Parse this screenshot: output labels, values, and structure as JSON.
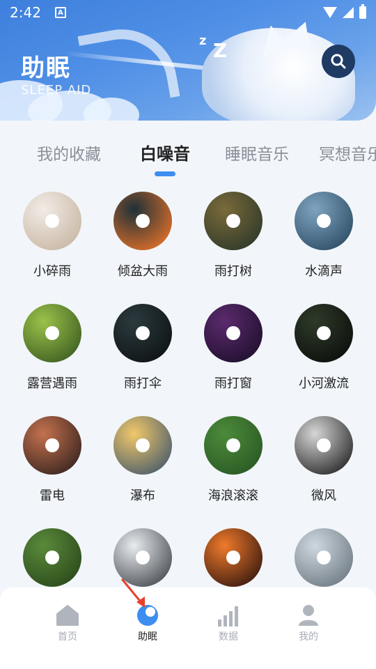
{
  "status_bar": {
    "time": "2:42",
    "notif_letter": "A"
  },
  "header": {
    "title": "助眠",
    "subtitle": "SLEEP AID",
    "zz": [
      "z",
      "Z"
    ]
  },
  "tabs": [
    {
      "label": "我的收藏",
      "active": false
    },
    {
      "label": "白噪音",
      "active": true
    },
    {
      "label": "睡眠音乐",
      "active": false
    },
    {
      "label": "冥想音乐",
      "active": false
    }
  ],
  "sounds": [
    {
      "label": "小碎雨",
      "colors": [
        "#f1ece6",
        "#c9b7a4"
      ]
    },
    {
      "label": "倾盆大雨",
      "colors": [
        "#1e3038",
        "#e0702a"
      ]
    },
    {
      "label": "雨打树",
      "colors": [
        "#7a6a3a",
        "#2f3a2a"
      ]
    },
    {
      "label": "水滴声",
      "colors": [
        "#7fa4c0",
        "#2f4e66"
      ]
    },
    {
      "label": "露营遇雨",
      "colors": [
        "#9bc24a",
        "#3f5f22"
      ]
    },
    {
      "label": "雨打伞",
      "colors": [
        "#2c3a3e",
        "#0e1416"
      ]
    },
    {
      "label": "雨打窗",
      "colors": [
        "#5b2a6e",
        "#20102e"
      ]
    },
    {
      "label": "小河激流",
      "colors": [
        "#2e3a2a",
        "#0d100c"
      ]
    },
    {
      "label": "雷电",
      "colors": [
        "#c4724e",
        "#3a2520"
      ]
    },
    {
      "label": "瀑布",
      "colors": [
        "#f1c86a",
        "#4b5d6b"
      ]
    },
    {
      "label": "海浪滚滚",
      "colors": [
        "#4c8a3a",
        "#2a5a24"
      ]
    },
    {
      "label": "微风",
      "colors": [
        "#d7d7d7",
        "#2a2a2a"
      ]
    },
    {
      "label": "",
      "colors": [
        "#5a8a3a",
        "#2b4a1c"
      ]
    },
    {
      "label": "",
      "colors": [
        "#e9ecef",
        "#4a4f55"
      ]
    },
    {
      "label": "",
      "colors": [
        "#f07a2a",
        "#3a1a10"
      ]
    },
    {
      "label": "",
      "colors": [
        "#cfd8df",
        "#6f7b85"
      ]
    }
  ],
  "bottom_nav": [
    {
      "label": "首页",
      "icon": "home-icon",
      "active": false
    },
    {
      "label": "助眠",
      "icon": "moon-icon",
      "active": true
    },
    {
      "label": "数据",
      "icon": "bar-chart-icon",
      "active": false
    },
    {
      "label": "我的",
      "icon": "user-icon",
      "active": false
    }
  ],
  "colors": {
    "accent": "#3d8ef0",
    "inactive_nav": "#a7acb5",
    "arrow": "#e8402f"
  }
}
